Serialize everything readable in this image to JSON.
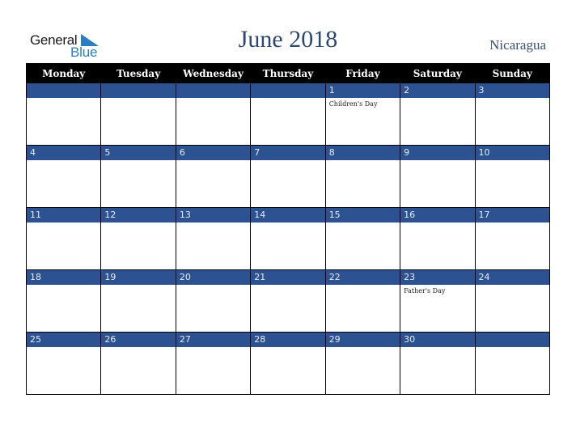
{
  "logo": {
    "line1": "General",
    "line2": "Blue",
    "accent_color": "#2a7fc1"
  },
  "header": {
    "title": "June 2018",
    "country": "Nicaragua"
  },
  "colors": {
    "header_bg": "#000000",
    "day_bar": "#2d5292",
    "title": "#2c4772"
  },
  "weekdays": [
    "Monday",
    "Tuesday",
    "Wednesday",
    "Thursday",
    "Friday",
    "Saturday",
    "Sunday"
  ],
  "weeks": [
    [
      {
        "day": ""
      },
      {
        "day": ""
      },
      {
        "day": ""
      },
      {
        "day": ""
      },
      {
        "day": "1",
        "holiday": "Children's Day"
      },
      {
        "day": "2"
      },
      {
        "day": "3"
      }
    ],
    [
      {
        "day": "4"
      },
      {
        "day": "5"
      },
      {
        "day": "6"
      },
      {
        "day": "7"
      },
      {
        "day": "8"
      },
      {
        "day": "9"
      },
      {
        "day": "10"
      }
    ],
    [
      {
        "day": "11"
      },
      {
        "day": "12"
      },
      {
        "day": "13"
      },
      {
        "day": "14"
      },
      {
        "day": "15"
      },
      {
        "day": "16"
      },
      {
        "day": "17"
      }
    ],
    [
      {
        "day": "18"
      },
      {
        "day": "19"
      },
      {
        "day": "20"
      },
      {
        "day": "21"
      },
      {
        "day": "22"
      },
      {
        "day": "23",
        "holiday": "Father's Day"
      },
      {
        "day": "24"
      }
    ],
    [
      {
        "day": "25"
      },
      {
        "day": "26"
      },
      {
        "day": "27"
      },
      {
        "day": "28"
      },
      {
        "day": "29"
      },
      {
        "day": "30"
      },
      {
        "day": ""
      }
    ]
  ]
}
